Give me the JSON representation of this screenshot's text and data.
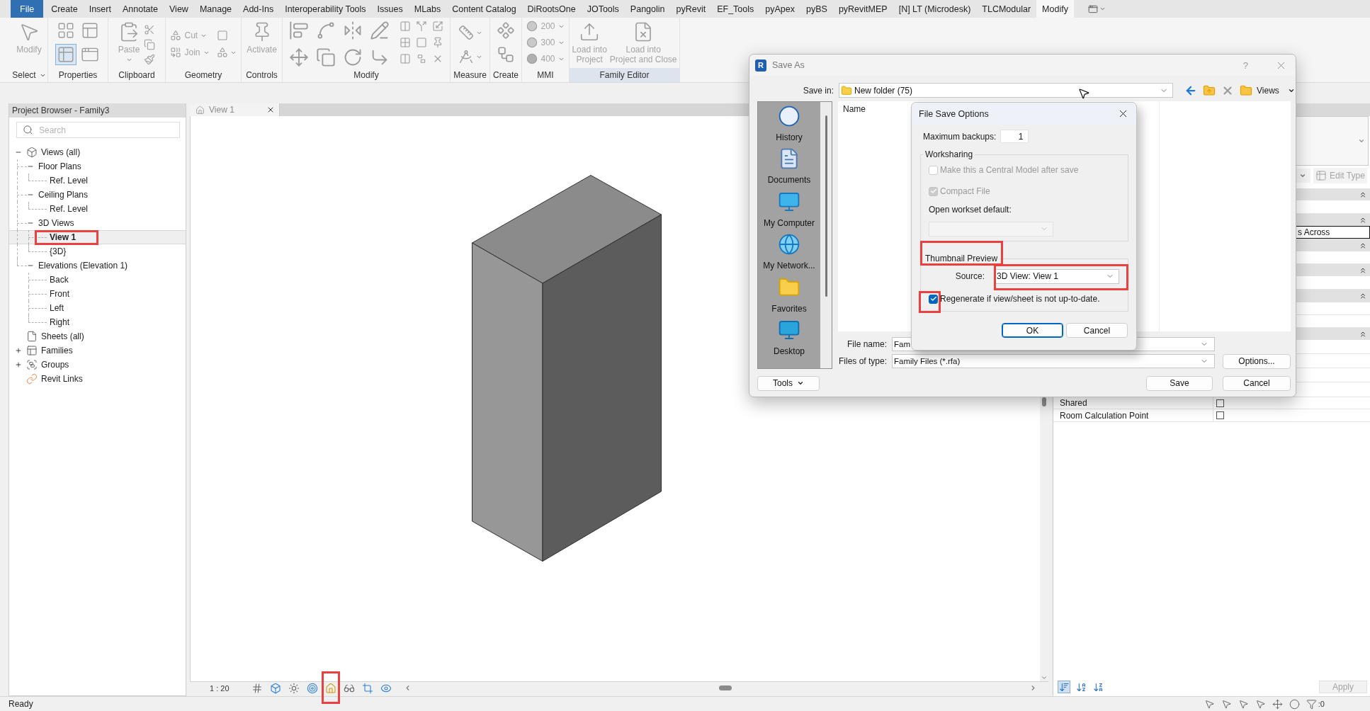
{
  "ribbon": {
    "tabs": [
      {
        "label": "File",
        "kind": "application",
        "selected": false
      },
      {
        "label": "Create",
        "kind": "tab",
        "selected": false
      },
      {
        "label": "Insert",
        "kind": "tab",
        "selected": false
      },
      {
        "label": "Annotate",
        "kind": "tab",
        "selected": false
      },
      {
        "label": "View",
        "kind": "tab",
        "selected": false
      },
      {
        "label": "Manage",
        "kind": "tab",
        "selected": false
      },
      {
        "label": "Add-Ins",
        "kind": "tab",
        "selected": false
      },
      {
        "label": "Interoperability Tools",
        "kind": "tab",
        "selected": false
      },
      {
        "label": "Issues",
        "kind": "tab",
        "selected": false
      },
      {
        "label": "MLabs",
        "kind": "tab",
        "selected": false
      },
      {
        "label": "Content Catalog",
        "kind": "tab",
        "selected": false
      },
      {
        "label": "DiRootsOne",
        "kind": "tab",
        "selected": false
      },
      {
        "label": "JOTools",
        "kind": "tab",
        "selected": false
      },
      {
        "label": "Pangolin",
        "kind": "tab",
        "selected": false
      },
      {
        "label": "pyRevit",
        "kind": "tab",
        "selected": false
      },
      {
        "label": "EF_Tools",
        "kind": "tab",
        "selected": false
      },
      {
        "label": "pyApex",
        "kind": "tab",
        "selected": false
      },
      {
        "label": "pyBS",
        "kind": "tab",
        "selected": false
      },
      {
        "label": "pyRevitMEP",
        "kind": "tab",
        "selected": false
      },
      {
        "label": "[N] LT (Microdesk)",
        "kind": "tab",
        "selected": false
      },
      {
        "label": "TLCModular",
        "kind": "tab",
        "selected": false
      },
      {
        "label": "Modify",
        "kind": "tab",
        "selected": true
      }
    ],
    "panels": [
      {
        "label": "Select",
        "menu": true,
        "contextual": false,
        "buttons": [
          {
            "kind": "large",
            "label": "Modify",
            "menu": false,
            "disabled": true
          }
        ]
      },
      {
        "label": "Properties",
        "menu": false,
        "contextual": false,
        "toggles": [
          {
            "selected": false
          },
          {
            "selected": false
          },
          {
            "selected": true
          },
          {
            "selected": false
          }
        ]
      },
      {
        "label": "Clipboard",
        "menu": false,
        "contextual": false,
        "buttons": [
          {
            "kind": "large",
            "label": "Paste",
            "menu": true,
            "disabled": true
          }
        ]
      },
      {
        "label": "Geometry",
        "menu": false,
        "contextual": false,
        "buttons": [
          {
            "kind": "small",
            "label": "Cut",
            "menu": true,
            "disabled": true
          },
          {
            "kind": "small",
            "label": "Join",
            "menu": true,
            "disabled": true
          }
        ]
      },
      {
        "label": "Controls",
        "menu": false,
        "contextual": false,
        "buttons": [
          {
            "kind": "large",
            "label": "Activate",
            "menu": false,
            "disabled": true
          }
        ]
      },
      {
        "label": "Modify",
        "menu": false,
        "contextual": false
      },
      {
        "label": "Measure",
        "menu": false,
        "contextual": false
      },
      {
        "label": "Create",
        "menu": false,
        "contextual": false
      },
      {
        "label": "MMI",
        "menu": false,
        "contextual": false,
        "buttons": [
          {
            "kind": "small",
            "label": "200",
            "menu": true,
            "disabled": true
          },
          {
            "kind": "small",
            "label": "300",
            "menu": true,
            "disabled": true
          },
          {
            "kind": "small",
            "label": "400",
            "menu": true,
            "disabled": true
          }
        ]
      },
      {
        "label": "Family Editor",
        "menu": false,
        "contextual": true,
        "buttons": [
          {
            "kind": "large",
            "label": "Load into\nProject",
            "menu": false,
            "disabled": true
          },
          {
            "kind": "large",
            "label": "Load into\nProject and Close",
            "menu": false,
            "disabled": true
          }
        ]
      }
    ]
  },
  "project_browser": {
    "title": "Project Browser - Family3",
    "search": {
      "placeholder": "Search"
    },
    "tree": [
      {
        "kind": "views",
        "label": "Views (all)",
        "expanded": true,
        "selected": false,
        "highlighted": false,
        "children": [
          {
            "label": "Floor Plans",
            "expanded": true,
            "selected": false,
            "highlighted": false,
            "children": [
              {
                "label": "Ref. Level",
                "selected": false,
                "highlighted": false
              }
            ]
          },
          {
            "label": "Ceiling Plans",
            "expanded": true,
            "selected": false,
            "highlighted": false,
            "children": [
              {
                "label": "Ref. Level",
                "selected": false,
                "highlighted": false
              }
            ]
          },
          {
            "label": "3D Views",
            "expanded": true,
            "selected": false,
            "highlighted": false,
            "children": [
              {
                "label": "View 1",
                "selected": true,
                "highlighted": true
              },
              {
                "label": "{3D}",
                "selected": false,
                "highlighted": false
              }
            ]
          },
          {
            "label": "Elevations (Elevation 1)",
            "expanded": true,
            "selected": false,
            "highlighted": false,
            "children": [
              {
                "label": "Back",
                "selected": false,
                "highlighted": false
              },
              {
                "label": "Front",
                "selected": false,
                "highlighted": false
              },
              {
                "label": "Left",
                "selected": false,
                "highlighted": false
              },
              {
                "label": "Right",
                "selected": false,
                "highlighted": false
              }
            ]
          }
        ]
      },
      {
        "kind": "sheets",
        "label": "Sheets (all)",
        "selected": false,
        "highlighted": false
      },
      {
        "kind": "families",
        "label": "Families",
        "expanded": false,
        "selected": false,
        "highlighted": false
      },
      {
        "kind": "groups",
        "label": "Groups",
        "expanded": false,
        "selected": false,
        "highlighted": false
      },
      {
        "kind": "links",
        "label": "Revit Links",
        "selected": false,
        "highlighted": false
      }
    ]
  },
  "view": {
    "tabs": [
      {
        "label": "View 1",
        "selected": true
      }
    ],
    "control_bar": {
      "scale": "1 : 20",
      "tools": [
        {
          "highlighted": false
        },
        {
          "highlighted": false
        },
        {
          "highlighted": false
        },
        {
          "highlighted": false
        },
        {
          "highlighted": true
        },
        {
          "highlighted": false
        },
        {
          "highlighted": false
        },
        {
          "highlighted": false
        }
      ]
    }
  },
  "properties": {
    "edit_type": {
      "label": "Edit Type",
      "disabled": true
    },
    "field_value": "s Across",
    "rows": [
      {
        "label": "Shared",
        "checked": false
      },
      {
        "label": "Room Calculation Point",
        "checked": false
      }
    ],
    "sort_tools": [
      {
        "selected": true
      },
      {
        "selected": false
      },
      {
        "selected": false
      }
    ],
    "apply": {
      "label": "Apply",
      "disabled": true
    }
  },
  "status_bar": {
    "text": "Ready",
    "filter_count": ":0"
  },
  "save_as_dialog": {
    "logo": "R",
    "title": "Save As",
    "help": "?",
    "save_in": {
      "label": "Save in:",
      "value": "New folder (75)"
    },
    "views_button": "Views",
    "places": [
      {
        "kind": "history",
        "label": "History"
      },
      {
        "kind": "documents",
        "label": "Documents"
      },
      {
        "kind": "computer",
        "label": "My Computer"
      },
      {
        "kind": "network",
        "label": "My Network..."
      },
      {
        "kind": "favorites",
        "label": "Favorites"
      },
      {
        "kind": "desktop",
        "label": "Desktop"
      }
    ],
    "file_list": {
      "columns": [
        "Name"
      ]
    },
    "file_name": {
      "label": "File name:",
      "value": "Fam"
    },
    "file_type": {
      "label": "Files of type:",
      "value": "Family Files (*.rfa)"
    },
    "options_button": "Options...",
    "tools_button": "Tools",
    "save_button": "Save",
    "cancel_button": "Cancel"
  },
  "file_save_options": {
    "title": "File Save Options",
    "max_backups": {
      "label": "Maximum backups:",
      "value": "1"
    },
    "worksharing": {
      "title": "Worksharing",
      "options": [
        {
          "label": "Make this a Central Model after save",
          "checked": false,
          "disabled": true
        },
        {
          "label": "Compact File",
          "checked": true,
          "disabled": true
        }
      ],
      "workset": {
        "label": "Open workset default:",
        "disabled": true
      }
    },
    "thumbnail": {
      "title": "Thumbnail Preview",
      "title_highlighted": true,
      "source": {
        "label": "Source:",
        "value": "3D View: View 1",
        "highlighted": true
      },
      "regenerate": {
        "label": "Regenerate if view/sheet is not up-to-date.",
        "checked": true,
        "disabled": false,
        "highlighted": true
      }
    },
    "buttons": [
      {
        "label": "OK",
        "default": true
      },
      {
        "label": "Cancel",
        "default": false
      }
    ]
  }
}
